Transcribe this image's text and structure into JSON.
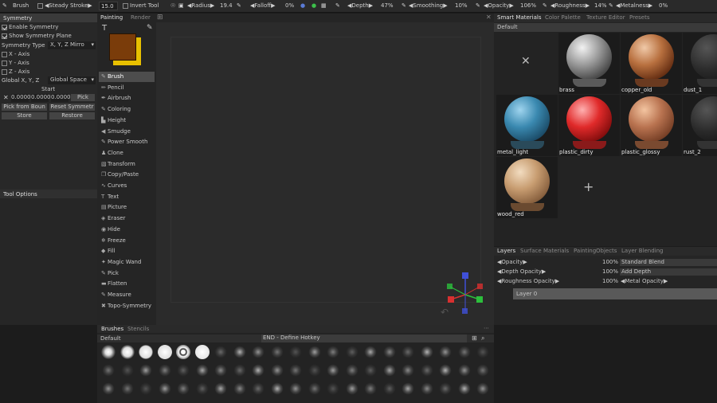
{
  "toolbar": {
    "tool_name": "Brush",
    "brush_size": "15.0",
    "steady_stroke": "Steady Stroke",
    "invert_tool": "Invert Tool",
    "radius_label": "Radius",
    "radius_value": "19.4",
    "falloff_label": "Falloff",
    "falloff_value": "0%",
    "depth_label": "Depth",
    "depth_value": "47%",
    "smoothing_label": "Smoothing",
    "smoothing_value": "10%",
    "opacity_label": "Opacity",
    "opacity_value": "106%",
    "roughness_label": "Roughness",
    "roughness_value": "14%",
    "metalness_label": "Metalness",
    "metalness_value": "0%"
  },
  "symmetry": {
    "title": "Symmetry",
    "enable": "Enable Symmetry",
    "show_plane": "Show Symmetry Plane",
    "type_label": "Symmetry Type",
    "type_value": "X, Y, Z Mirro",
    "x_axis": "X - Axis",
    "y_axis": "Y - Axis",
    "z_axis": "Z - Axis",
    "global_label": "Global X, Y, Z",
    "space_value": "Global Space",
    "start": "Start",
    "sx": "0.0000",
    "sy": "0.0000",
    "sz": "0.0000",
    "pick": "Pick",
    "pick_from_bounds": "Pick from Boun",
    "reset_symmetry": "Reset Symmetr",
    "store": "Store",
    "restore": "Restore"
  },
  "tool_options": {
    "title": "Tool Options"
  },
  "viewport_tabs": {
    "painting": "Painting",
    "render": "Render"
  },
  "tools": [
    {
      "label": "Brush",
      "icon": "brush-icon",
      "glyph": "✎"
    },
    {
      "label": "Pencil",
      "icon": "pencil-icon",
      "glyph": "✏"
    },
    {
      "label": "Airbrush",
      "icon": "airbrush-icon",
      "glyph": "✒"
    },
    {
      "label": "Coloring",
      "icon": "coloring-icon",
      "glyph": "✎"
    },
    {
      "label": "Height",
      "icon": "height-icon",
      "glyph": "▙"
    },
    {
      "label": "Smudge",
      "icon": "smudge-icon",
      "glyph": "◀"
    },
    {
      "label": "Power Smooth",
      "icon": "power-smooth-icon",
      "glyph": "✎"
    },
    {
      "label": "Clone",
      "icon": "clone-icon",
      "glyph": "♟"
    },
    {
      "label": "Transform",
      "icon": "transform-icon",
      "glyph": "▧"
    },
    {
      "label": "Copy/Paste",
      "icon": "copy-paste-icon",
      "glyph": "❐"
    },
    {
      "label": "Curves",
      "icon": "curves-icon",
      "glyph": "∿"
    },
    {
      "label": "Text",
      "icon": "text-icon",
      "glyph": "T"
    },
    {
      "label": "Picture",
      "icon": "picture-icon",
      "glyph": "▤"
    },
    {
      "label": "Eraser",
      "icon": "eraser-icon",
      "glyph": "◈"
    },
    {
      "label": "Hide",
      "icon": "hide-icon",
      "glyph": "◉"
    },
    {
      "label": "Freeze",
      "icon": "freeze-icon",
      "glyph": "❄"
    },
    {
      "label": "Fill",
      "icon": "fill-icon",
      "glyph": "◆"
    },
    {
      "label": "Magic Wand",
      "icon": "magic-wand-icon",
      "glyph": "✦"
    },
    {
      "label": "Pick",
      "icon": "pick-icon",
      "glyph": "✎"
    },
    {
      "label": "Flatten",
      "icon": "flatten-icon",
      "glyph": "▬"
    },
    {
      "label": "Measure",
      "icon": "measure-icon",
      "glyph": "✎"
    },
    {
      "label": "Topo-Symmetry",
      "icon": "topo-symmetry-icon",
      "glyph": "✖"
    }
  ],
  "colors": {
    "primary": "#7a3c0a",
    "secondary": "#e8c000"
  },
  "materials": {
    "tabs": [
      "Smart Materials",
      "Color Palette",
      "Texture Editor",
      "Presets"
    ],
    "folder": "Default",
    "items": [
      {
        "label": "brass"
      },
      {
        "label": "copper_old"
      },
      {
        "label": "dust_1"
      },
      {
        "label": "metal_light"
      },
      {
        "label": "plastic_dirty"
      },
      {
        "label": "plastic_glossy"
      },
      {
        "label": "rust_2"
      },
      {
        "label": "wood_red"
      }
    ],
    "clear_glyph": "✕",
    "add_glyph": "+"
  },
  "layers": {
    "tabs": [
      "Layers",
      "Surface",
      "Materials",
      "Painting",
      "Objects",
      "Layer Blending"
    ],
    "opacity_label": "Opacity",
    "opacity_value": "100%",
    "blend_mode": "Standard Blend",
    "depth_opacity_label": "Depth Opacity",
    "depth_opacity_value": "100%",
    "depth_mode": "Add Depth",
    "roughness_opacity_label": "Roughness Opacity",
    "roughness_opacity_value": "100%",
    "metal_opacity_label": "Metal Opacity",
    "layer_name": "Layer 0"
  },
  "brushes": {
    "tabs": [
      "Brushes",
      "Stencils"
    ],
    "folder": "Default",
    "hint": "END - Define Hotkey"
  }
}
